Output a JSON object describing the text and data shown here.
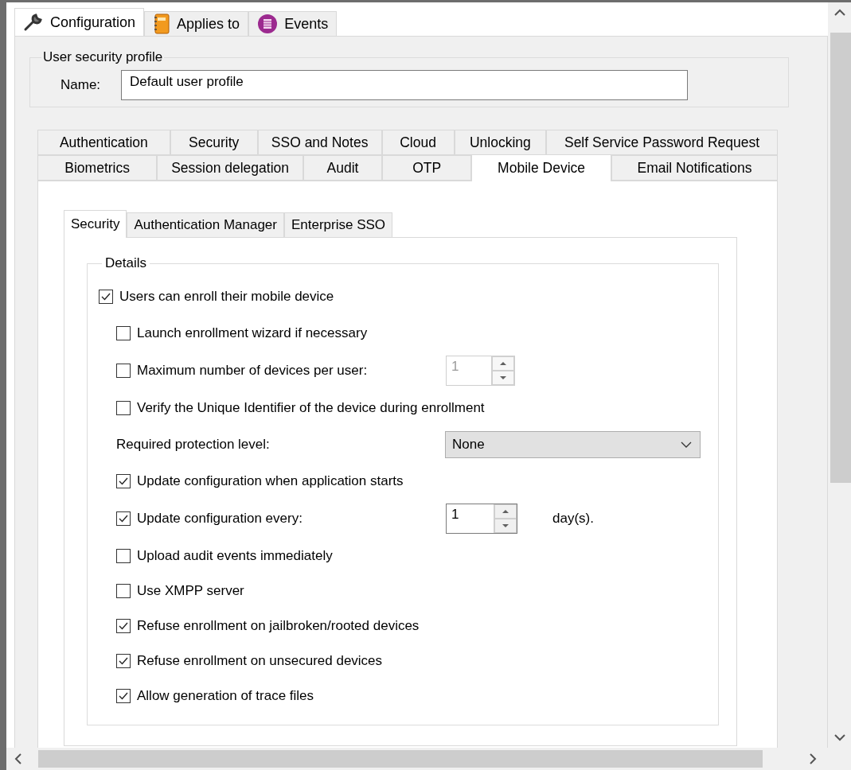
{
  "top_tabs": [
    {
      "label": "Configuration",
      "selected": true
    },
    {
      "label": "Applies to",
      "selected": false
    },
    {
      "label": "Events",
      "selected": false
    }
  ],
  "profile": {
    "legend": "User security profile",
    "name_label": "Name:",
    "name_value": "Default user profile"
  },
  "settings_tabs": [
    [
      {
        "label": "Authentication",
        "selected": false
      },
      {
        "label": "Security",
        "selected": false
      },
      {
        "label": "SSO and Notes",
        "selected": false
      },
      {
        "label": "Cloud",
        "selected": false
      },
      {
        "label": "Unlocking",
        "selected": false
      },
      {
        "label": "Self Service Password Request",
        "selected": false
      }
    ],
    [
      {
        "label": "Biometrics",
        "selected": false
      },
      {
        "label": "Session delegation",
        "selected": false
      },
      {
        "label": "Audit",
        "selected": false
      },
      {
        "label": "OTP",
        "selected": false
      },
      {
        "label": "Mobile Device",
        "selected": true
      },
      {
        "label": "Email Notifications",
        "selected": false
      }
    ]
  ],
  "sub_tabs": [
    {
      "label": "Security",
      "selected": true
    },
    {
      "label": "Authentication Manager",
      "selected": false
    },
    {
      "label": "Enterprise SSO",
      "selected": false
    }
  ],
  "details": {
    "legend": "Details",
    "options": [
      {
        "kind": "checkbox",
        "label": "Users can enroll their mobile device",
        "checked": true,
        "children": [
          {
            "kind": "checkbox",
            "label": "Launch enrollment wizard if necessary",
            "checked": false
          },
          {
            "kind": "spin",
            "label": "Maximum number of devices per user:",
            "checked": false,
            "value": "1",
            "disabled": true
          },
          {
            "kind": "checkbox",
            "label": "Verify the Unique Identifier of the device during enrollment",
            "checked": false
          },
          {
            "kind": "select",
            "label": "Required protection level:",
            "value": "None"
          },
          {
            "kind": "checkbox",
            "label": "Update configuration when application starts",
            "checked": true
          },
          {
            "kind": "spin",
            "label": "Update configuration every:",
            "checked": true,
            "value": "1",
            "disabled": false,
            "suffix": "day(s)."
          },
          {
            "kind": "checkbox",
            "label": "Upload audit events immediately",
            "checked": false
          },
          {
            "kind": "checkbox",
            "label": "Use XMPP server",
            "checked": false
          },
          {
            "kind": "checkbox",
            "label": "Refuse enrollment on jailbroken/rooted devices",
            "checked": true
          },
          {
            "kind": "checkbox",
            "label": "Refuse enrollment on unsecured devices",
            "checked": true
          },
          {
            "kind": "checkbox",
            "label": "Allow generation of trace files",
            "checked": true
          }
        ]
      }
    ]
  }
}
